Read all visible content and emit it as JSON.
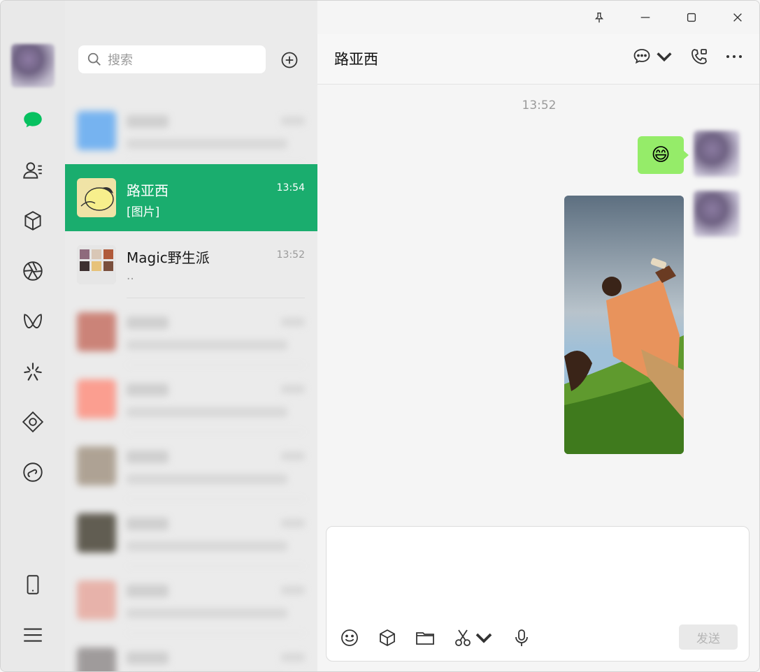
{
  "search": {
    "placeholder": "搜索"
  },
  "chats": [
    {
      "name": "",
      "time": "",
      "preview": "",
      "blurred": true,
      "color": "#5aa6f2"
    },
    {
      "name": "路亚西",
      "time": "13:54",
      "preview": "[图片]",
      "active": true
    },
    {
      "name": "Magic野生派",
      "time": "13:52",
      "preview": ".."
    },
    {
      "name": "",
      "time": "",
      "preview": "",
      "blurred": true,
      "color": "#c46a5c"
    },
    {
      "name": "",
      "time": "",
      "preview": "",
      "blurred": true,
      "color": "#ff8b7a"
    },
    {
      "name": "",
      "time": "",
      "preview": "",
      "blurred": true,
      "color": "#a0917f"
    },
    {
      "name": "",
      "time": "",
      "preview": "",
      "blurred": true,
      "color": "#3f3a2c"
    },
    {
      "name": "",
      "time": "",
      "preview": "",
      "blurred": true,
      "color": "#e7a59a"
    },
    {
      "name": "",
      "time": "",
      "preview": "",
      "blurred": true,
      "color": "#8d8888"
    }
  ],
  "conversation": {
    "title": "路亚西",
    "timestamp": "13:52",
    "emoji": "😄"
  },
  "composer": {
    "send_label": "发送"
  },
  "colors": {
    "accent": "#1aad6e",
    "bubble": "#95ec69",
    "chat_nav": "#07c160"
  }
}
